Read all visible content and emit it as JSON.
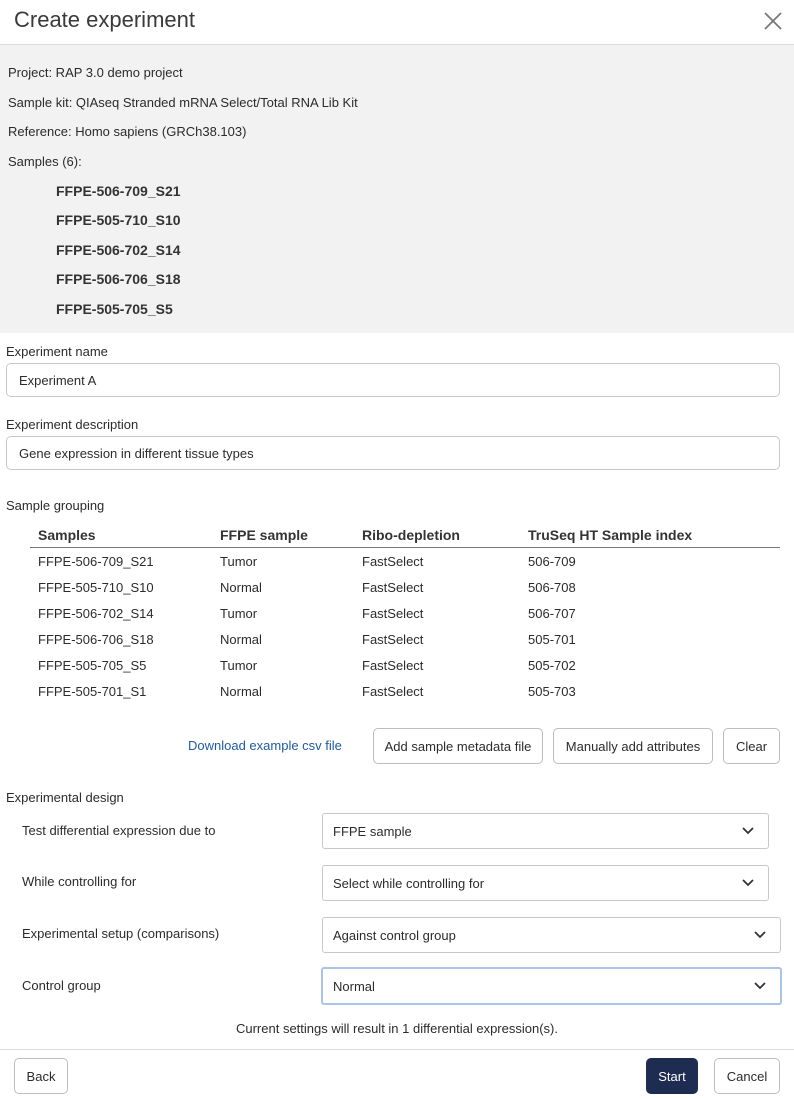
{
  "dialog": {
    "title": "Create experiment"
  },
  "summary": {
    "project": "Project: RAP 3.0 demo project",
    "sample_kit": "Sample kit: QIAseq Stranded mRNA Select/Total RNA Lib Kit",
    "reference": "Reference: Homo sapiens (GRCh38.103)",
    "samples_label": "Samples (6):",
    "samples": [
      "FFPE-506-709_S21",
      "FFPE-505-710_S10",
      "FFPE-506-702_S14",
      "FFPE-506-706_S18",
      "FFPE-505-705_S5"
    ]
  },
  "form": {
    "name_label": "Experiment name",
    "name_value": "Experiment A",
    "description_label": "Experiment description",
    "description_value": "Gene expression in different tissue types"
  },
  "grouping": {
    "label": "Sample grouping",
    "columns": [
      "Samples",
      "FFPE sample",
      "Ribo-depletion",
      "TruSeq HT Sample index"
    ],
    "rows": [
      [
        "FFPE-506-709_S21",
        "Tumor",
        "FastSelect",
        "506-709"
      ],
      [
        "FFPE-505-710_S10",
        "Normal",
        "FastSelect",
        "506-708"
      ],
      [
        "FFPE-506-702_S14",
        "Tumor",
        "FastSelect",
        "506-707"
      ],
      [
        "FFPE-506-706_S18",
        "Normal",
        "FastSelect",
        "505-701"
      ],
      [
        "FFPE-505-705_S5",
        "Tumor",
        "FastSelect",
        "505-702"
      ],
      [
        "FFPE-505-701_S1",
        "Normal",
        "FastSelect",
        "505-703"
      ]
    ],
    "download_link": "Download example csv file",
    "add_metadata_button": "Add sample metadata file",
    "manual_button": "Manually add attributes",
    "clear_button": "Clear"
  },
  "design": {
    "label": "Experimental design",
    "fields": [
      {
        "label": "Test differential expression due to",
        "value": "FFPE sample"
      },
      {
        "label": "While controlling for",
        "value": "Select while controlling for"
      },
      {
        "label": "Experimental setup (comparisons)",
        "value": "Against control group"
      },
      {
        "label": "Control group",
        "value": "Normal"
      }
    ],
    "result_text": "Current settings will result in 1 differential expression(s)."
  },
  "footer": {
    "back": "Back",
    "start": "Start",
    "cancel": "Cancel"
  },
  "colors": {
    "primary": "#1e2c52",
    "link": "#1f5aa6",
    "summary_bg": "#f3f2f2",
    "focus": "#a9c4e8"
  },
  "icons": {
    "close": "close-icon",
    "dropdown": "chevron-down-icon"
  }
}
